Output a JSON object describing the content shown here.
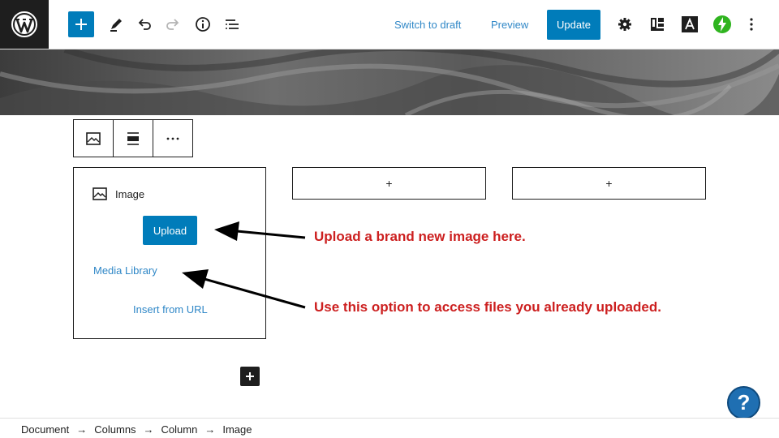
{
  "toolbar": {
    "switch_to_draft": "Switch to draft",
    "preview": "Preview",
    "update": "Update",
    "icons": [
      "wordpress-logo-icon",
      "plus-icon",
      "pencil-icon",
      "undo-icon",
      "redo-icon",
      "info-icon",
      "list-view-icon",
      "gear-icon",
      "block-layout-icon",
      "a-letter-icon",
      "bolt-icon",
      "more-vertical-icon"
    ],
    "accent_color": "#007cba"
  },
  "block_toolbar": {
    "icons": [
      "image-icon",
      "align-icon",
      "more-horizontal-icon"
    ]
  },
  "image_block": {
    "label": "Image",
    "upload": "Upload",
    "media_library": "Media Library",
    "insert_url": "Insert from URL"
  },
  "columns": {
    "appender_symbol": "+"
  },
  "annotations": {
    "upload_note": "Upload a brand new image here.",
    "library_note": "Use this option to access files you already uploaded.",
    "color": "#cc1f1f"
  },
  "help": {
    "symbol": "?"
  },
  "breadcrumb": {
    "items": [
      "Document",
      "Columns",
      "Column",
      "Image"
    ],
    "separator": "→"
  }
}
